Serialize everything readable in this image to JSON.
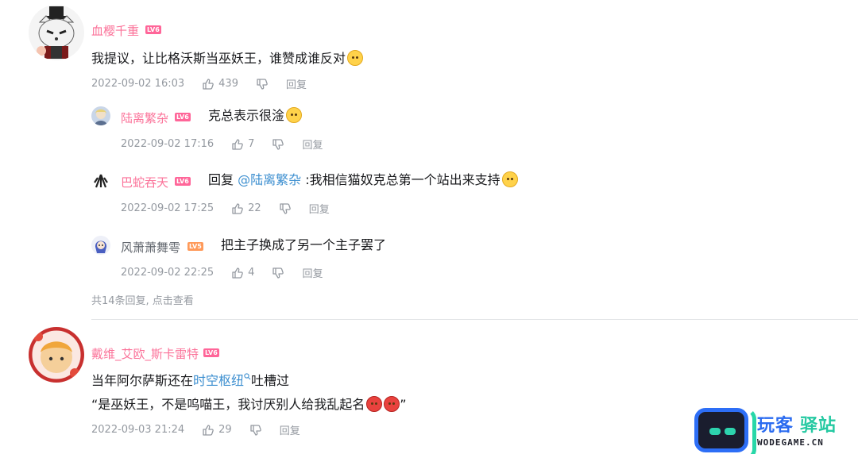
{
  "comments": [
    {
      "user": "血樱千重",
      "level": "LV6",
      "text": "我提议，让比格沃斯当巫妖王，谁赞成谁反对",
      "date": "2022-09-02 16:03",
      "likes": "439",
      "reply_label": "回复",
      "replies": [
        {
          "user": "陆离繁杂",
          "level": "LV6",
          "text": "克总表示很淦",
          "date": "2022-09-02 17:16",
          "likes": "7",
          "reply_label": "回复"
        },
        {
          "user": "巴蛇吞天",
          "level": "LV6",
          "prefix": "回复 ",
          "mention": "@陆离繁杂",
          "text": " :我相信猫奴克总第一个站出来支持",
          "date": "2022-09-02 17:25",
          "likes": "22",
          "reply_label": "回复"
        },
        {
          "user": "风萧萧舞雩",
          "level": "LV5",
          "text": "把主子换成了另一个主子罢了",
          "date": "2022-09-02 22:25",
          "likes": "4",
          "reply_label": "回复"
        }
      ],
      "more_replies": "共14条回复, 点击查看"
    },
    {
      "user": "戴维_艾欧_斯卡雷特",
      "level": "LV6",
      "text_line1_a": "当年阿尔萨斯还在",
      "text_line1_link": "时空枢纽",
      "text_line1_b": "吐槽过",
      "text_line2": "“是巫妖王，不是呜喵王，我讨厌别人给我乱起名",
      "text_line2_end": "”",
      "date": "2022-09-03 21:24",
      "likes": "29",
      "reply_label": "回复"
    }
  ],
  "brand": {
    "name_a": "玩客",
    "name_b": "驿站",
    "url": "WODEGAME.CN"
  },
  "colors": {
    "username": "#fb7299",
    "link": "#3d8fd0",
    "meta": "#9499a0",
    "brand_blue": "#2a6bf0",
    "brand_green": "#25c9a2"
  }
}
